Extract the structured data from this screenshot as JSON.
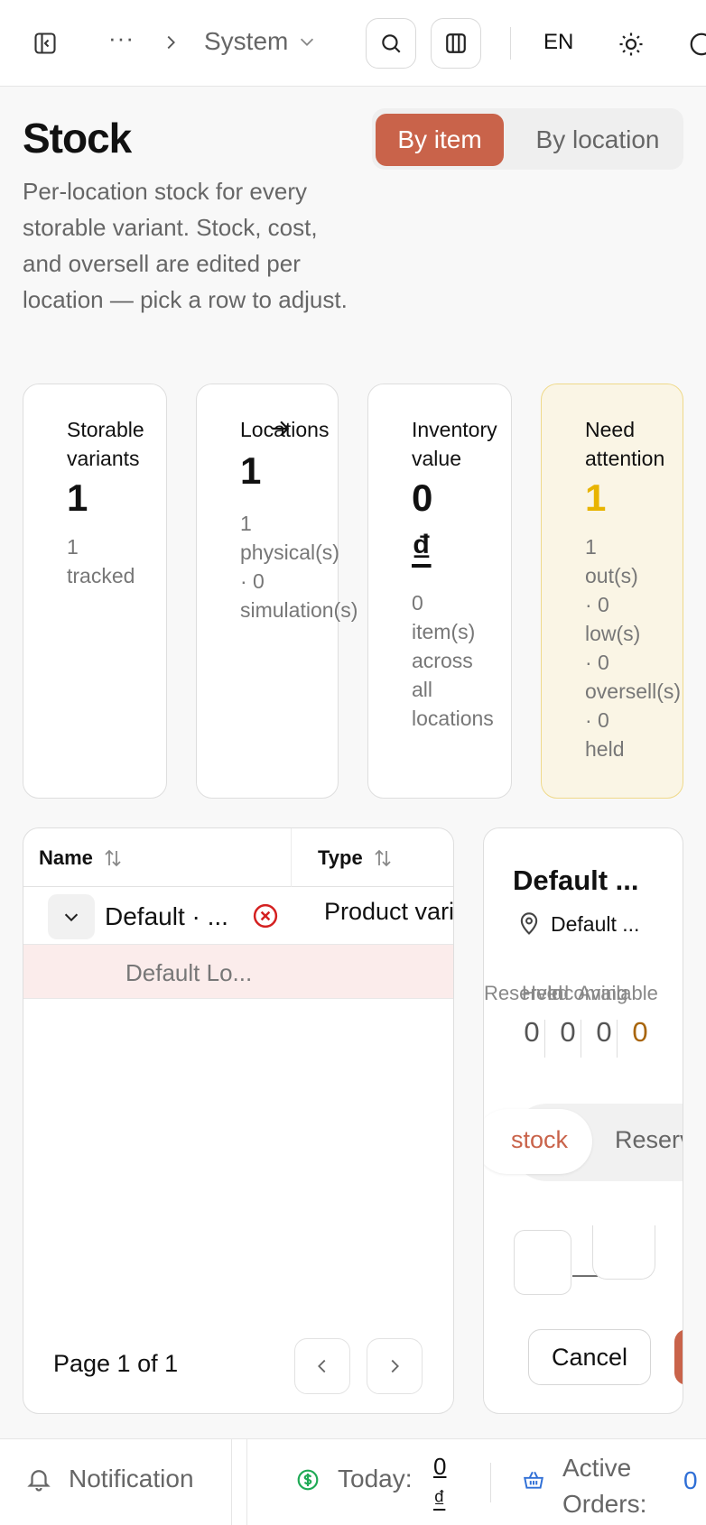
{
  "topbar": {
    "breadcrumb_ellipsis": "···",
    "breadcrumb_current": "System",
    "language": "EN"
  },
  "page": {
    "title": "Stock",
    "description": "Per-location stock for every storable variant. Stock, cost, and oversell are edited per location — pick a row to adjust.",
    "view_toggle": {
      "by_item": "By item",
      "by_location": "By location",
      "selected": "By item"
    }
  },
  "stats": {
    "storable": {
      "label": "Storable variants",
      "value": "1",
      "note": "1\ntracked"
    },
    "locations": {
      "label": "Locations",
      "value": "1",
      "note": "1\nphysical(s)\n· 0\nsimulation(s)"
    },
    "inventory": {
      "label": "Inventory value",
      "value": "0",
      "currency": "₫",
      "note": "0\nitem(s)\nacross\nall\nlocations"
    },
    "attention": {
      "label": "Need attention",
      "value": "1",
      "out": "1\nout(s)",
      "note": "· 0\nlow(s)\n· 0\noversell(s)\n· 0\nheld"
    }
  },
  "table": {
    "columns": {
      "name": "Name",
      "type": "Type"
    },
    "rows": [
      {
        "name": "Default · ...",
        "type": "Product variant",
        "sub_location": "Default Lo..."
      }
    ],
    "pager": "Page 1 of 1"
  },
  "detail": {
    "title": "Default ...",
    "location": "Default ...",
    "column_heads": [
      "Reserved",
      "Held",
      "Incoming",
      "Available"
    ],
    "values": [
      "0",
      "0",
      "0",
      "0"
    ],
    "tabs": {
      "stock": "stock",
      "reserve": "Reserve"
    },
    "cancel": "Cancel"
  },
  "footer": {
    "notification": "Notification",
    "today_label": "Today:",
    "today_value": "0\n₫",
    "orders_label": "Active\nOrders:",
    "orders_value": "0"
  },
  "colors": {
    "accent": "#c9634a",
    "attention_bg": "#faf5e5",
    "attention_value": "#e8b400",
    "error": "#d42020",
    "link_blue": "#2f6fd6"
  }
}
